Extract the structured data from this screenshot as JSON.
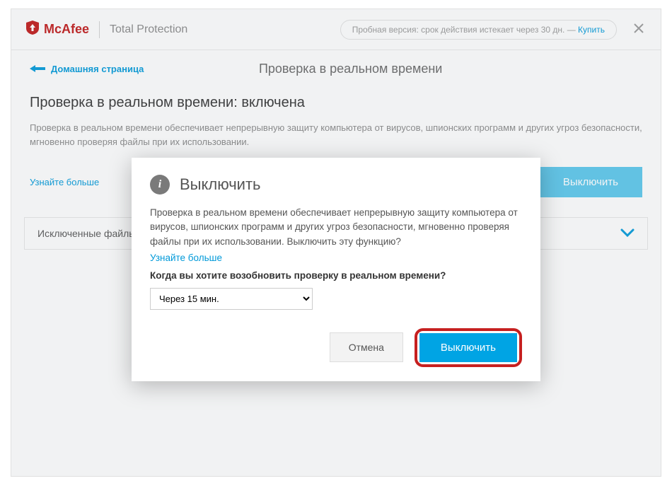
{
  "header": {
    "brand": "McAfee",
    "product": "Total Protection",
    "trial_text": "Пробная версия: срок действия истекает через 30 дн. — ",
    "buy_label": "Купить"
  },
  "navigation": {
    "back_label": "Домашняя страница",
    "page_title": "Проверка в реальном времени"
  },
  "main": {
    "status_heading": "Проверка в реальном времени: включена",
    "description": "Проверка в реальном времени обеспечивает непрерывную защиту компьютера от вирусов, шпионских программ и других угроз безопасности, мгновенно проверяя файлы при их использовании.",
    "learn_more": "Узнайте больше",
    "toggle_button": "Выключить",
    "accordion_label": "Исключенные файлы"
  },
  "modal": {
    "title": "Выключить",
    "body": "Проверка в реальном времени обеспечивает непрерывную защиту компьютера от вирусов, шпионских программ и других угроз безопасности, мгновенно проверяя файлы при их использовании. Выключить эту функцию?",
    "learn_more": "Узнайте больше",
    "question": "Когда вы хотите возобновить проверку в реальном времени?",
    "select_value": "Через 15 мин.",
    "cancel_label": "Отмена",
    "confirm_label": "Выключить"
  }
}
